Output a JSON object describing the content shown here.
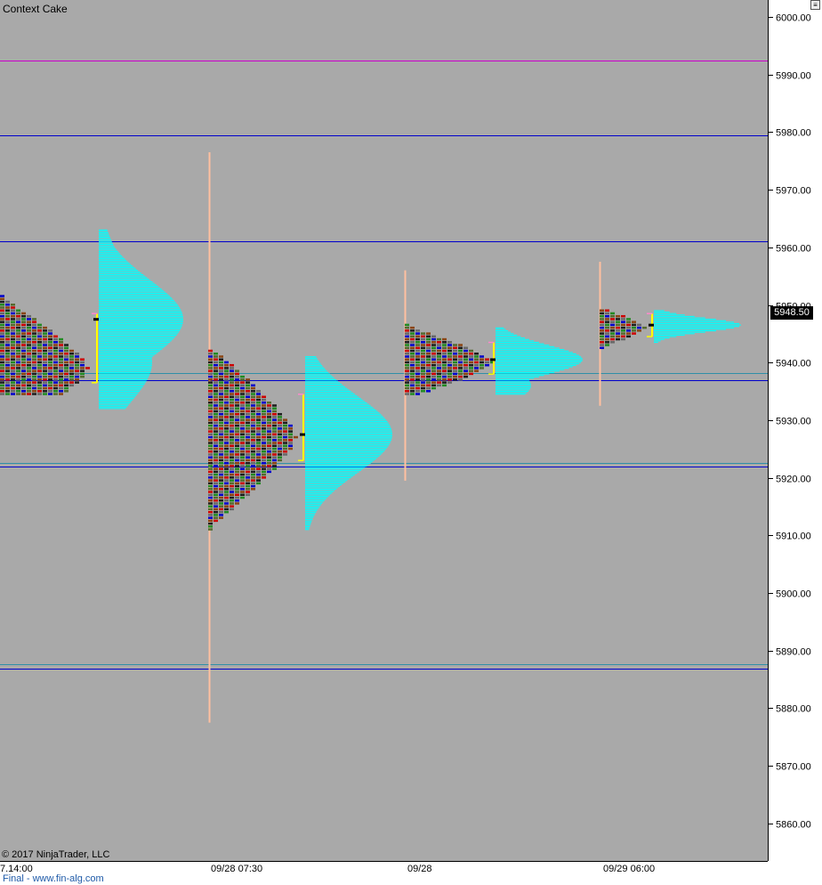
{
  "window": {
    "title": "Context Cake",
    "copyright": "© 2017 NinjaTrader, LLC",
    "footer_link": "Final - www.fin-alg.com",
    "corner_button": "≡"
  },
  "colors": {
    "plot_background": "#a9a9a9",
    "volume_profile": "#00ffff",
    "reference_line": "#0000cc",
    "top_line": "#cc00cc",
    "thin_line": "#2f8fa8",
    "range_bar": "#ffc0a0",
    "value_area": "#ffff00",
    "poc": "#000000"
  },
  "chart_data": {
    "type": "market-profile",
    "title": "Context Cake",
    "ylim": [
      5853,
      6003.5
    ],
    "y_ticks": [
      "6000.00",
      "5990.00",
      "5980.00",
      "5970.00",
      "5960.00",
      "5950.00",
      "5940.00",
      "5930.00",
      "5920.00",
      "5910.00",
      "5900.00",
      "5890.00",
      "5880.00",
      "5870.00",
      "5860.00"
    ],
    "x_ticks": [
      "7.14:00",
      "09/28 07:30",
      "09/28",
      "09/29 06:00"
    ],
    "last_price": "5948.50",
    "reference_lines": [
      {
        "price": 5992.5,
        "color": "#cc00cc"
      },
      {
        "price": 5979.4,
        "color": "#0000cc"
      },
      {
        "price": 5961.1,
        "color": "#0000cc"
      },
      {
        "price": 5938.2,
        "color": "#2f8fa8"
      },
      {
        "price": 5936.9,
        "color": "#0000cc"
      },
      {
        "price": 5922.6,
        "color": "#2f8fa8"
      },
      {
        "price": 5922.0,
        "color": "#0000cc"
      },
      {
        "price": 5887.6,
        "color": "#2f8fa8"
      },
      {
        "price": 5886.9,
        "color": "#0000cc"
      }
    ],
    "sessions": [
      {
        "label": "7.14:00",
        "tpo": {
          "low": 5934.5,
          "high": 5951.5,
          "peak": 5939,
          "width": 100,
          "start": 0
        },
        "profile": {
          "low": 5932,
          "high": 5963,
          "peaks": [
            {
              "p": 5947.5,
              "w": 95
            },
            {
              "p": 5940,
              "w": 60
            },
            {
              "p": 5952,
              "w": 35
            }
          ],
          "poc": 5947.5,
          "vah": 5948.5,
          "val": 5936.5
        }
      },
      {
        "label": "09/28 07:30",
        "range": {
          "low": 5877.5,
          "high": 5976.5
        },
        "tpo": {
          "low": 5911,
          "high": 5942,
          "peak": 5927,
          "width": 100,
          "start": 234
        },
        "profile": {
          "low": 5911,
          "high": 5941,
          "peaks": [
            {
              "p": 5927.5,
              "w": 98
            }
          ],
          "poc": 5927.5,
          "vah": 5934.5,
          "val": 5923
        }
      },
      {
        "label": "09/28",
        "range": {
          "low": 5919.5,
          "high": 5956
        },
        "tpo": {
          "low": 5934.5,
          "high": 5946.5,
          "peak": 5940,
          "width": 100,
          "start": 455
        },
        "profile": {
          "low": 5934.5,
          "high": 5946,
          "peaks": [
            {
              "p": 5940.5,
              "w": 98
            },
            {
              "p": 5936,
              "w": 40
            }
          ],
          "poc": 5940.5,
          "vah": 5943.5,
          "val": 5938
        }
      },
      {
        "label": "09/29 06:00",
        "range": {
          "low": 5932.5,
          "high": 5957.5
        },
        "tpo": {
          "low": 5942.5,
          "high": 5949,
          "peak": 5946,
          "width": 55,
          "start": 674
        },
        "profile": {
          "low": 5943.5,
          "high": 5949,
          "peaks": [
            {
              "p": 5946.5,
              "w": 98
            }
          ],
          "poc": 5946.5,
          "vah": 5948.5,
          "val": 5944.5
        }
      }
    ]
  }
}
